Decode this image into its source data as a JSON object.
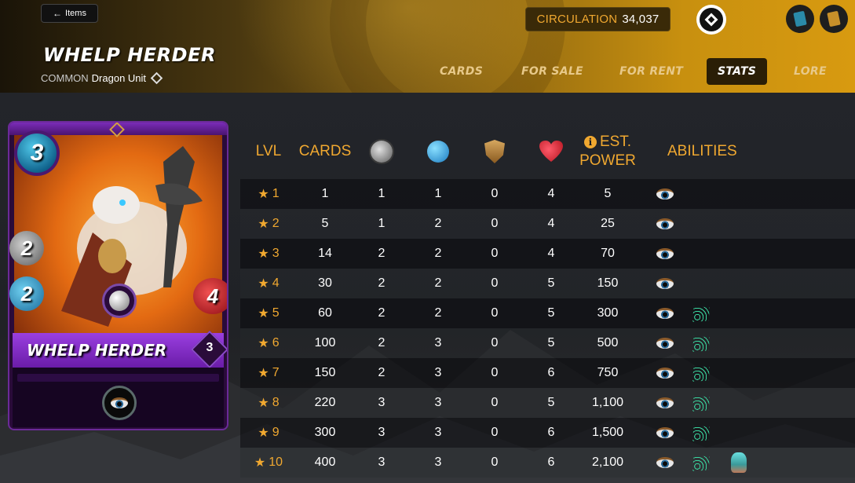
{
  "header": {
    "back_label": "Items",
    "title": "WHELP HERDER",
    "rarity": "COMMON",
    "unit_desc": "Dragon Unit",
    "circulation_label": "CIRCULATION",
    "circulation_value": "34,037",
    "tabs": [
      {
        "label": "CARDS",
        "active": false
      },
      {
        "label": "FOR SALE",
        "active": false
      },
      {
        "label": "FOR RENT",
        "active": false
      },
      {
        "label": "STATS",
        "active": true
      },
      {
        "label": "LORE",
        "active": false
      }
    ]
  },
  "card": {
    "name": "WHELP HERDER",
    "mana": "3",
    "melee": "2",
    "ranged": "2",
    "health": "4",
    "level": "3"
  },
  "stats": {
    "columns": {
      "lvl": "LVL",
      "cards": "CARDS",
      "melee_icon": "melee-attack-icon",
      "ranged_icon": "ranged-attack-icon",
      "armor_icon": "armor-icon",
      "health_icon": "health-icon",
      "est": "EST.",
      "power": "POWER",
      "abilities": "ABILITIES"
    },
    "rows": [
      {
        "lvl": "1",
        "cards": "1",
        "melee": "1",
        "ranged": "1",
        "armor": "0",
        "health": "4",
        "power": "5",
        "abilities": [
          "eye"
        ]
      },
      {
        "lvl": "2",
        "cards": "5",
        "melee": "1",
        "ranged": "2",
        "armor": "0",
        "health": "4",
        "power": "25",
        "abilities": [
          "eye"
        ]
      },
      {
        "lvl": "3",
        "cards": "14",
        "melee": "2",
        "ranged": "2",
        "armor": "0",
        "health": "4",
        "power": "70",
        "abilities": [
          "eye"
        ]
      },
      {
        "lvl": "4",
        "cards": "30",
        "melee": "2",
        "ranged": "2",
        "armor": "0",
        "health": "5",
        "power": "150",
        "abilities": [
          "eye"
        ]
      },
      {
        "lvl": "5",
        "cards": "60",
        "melee": "2",
        "ranged": "2",
        "armor": "0",
        "health": "5",
        "power": "300",
        "abilities": [
          "eye",
          "web"
        ]
      },
      {
        "lvl": "6",
        "cards": "100",
        "melee": "2",
        "ranged": "3",
        "armor": "0",
        "health": "5",
        "power": "500",
        "abilities": [
          "eye",
          "web"
        ]
      },
      {
        "lvl": "7",
        "cards": "150",
        "melee": "2",
        "ranged": "3",
        "armor": "0",
        "health": "6",
        "power": "750",
        "abilities": [
          "eye",
          "web"
        ]
      },
      {
        "lvl": "8",
        "cards": "220",
        "melee": "3",
        "ranged": "3",
        "armor": "0",
        "health": "5",
        "power": "1,100",
        "abilities": [
          "eye",
          "web"
        ]
      },
      {
        "lvl": "9",
        "cards": "300",
        "melee": "3",
        "ranged": "3",
        "armor": "0",
        "health": "6",
        "power": "1,500",
        "abilities": [
          "eye",
          "web"
        ]
      },
      {
        "lvl": "10",
        "cards": "400",
        "melee": "3",
        "ranged": "3",
        "armor": "0",
        "health": "6",
        "power": "2,100",
        "abilities": [
          "eye",
          "web",
          "trap"
        ]
      }
    ]
  },
  "colors": {
    "accent": "#f0a830",
    "header_gold": "#d89a10",
    "card_purple": "#6b2a98"
  }
}
